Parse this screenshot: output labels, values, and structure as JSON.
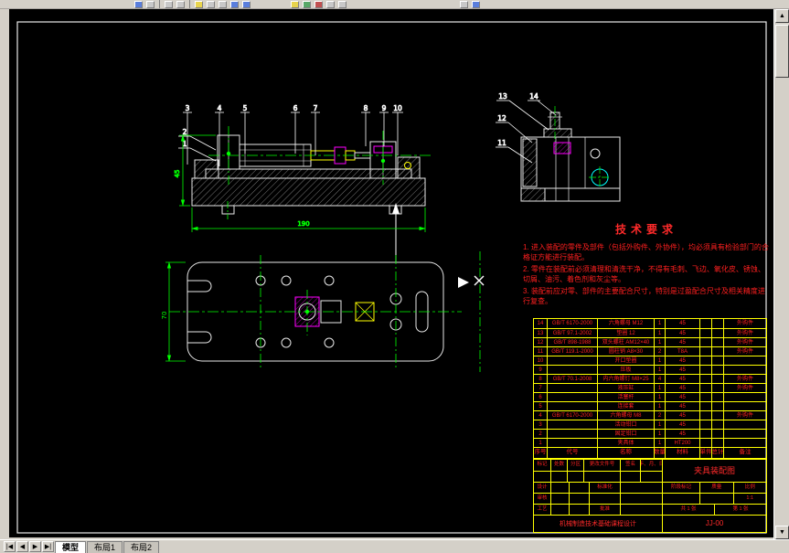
{
  "toolbar": {
    "icons": [
      "new",
      "open",
      "save",
      "print",
      "cut",
      "copy",
      "paste",
      "undo",
      "redo",
      "zoom-window",
      "zoom-previous",
      "pan",
      "layer",
      "color",
      "linetype",
      "help"
    ]
  },
  "scrollbar": {
    "up": "▲",
    "down": "▼"
  },
  "statusbar": {
    "nav": [
      "|◀",
      "◀",
      "▶",
      "▶|"
    ],
    "tabs": [
      "模型",
      "布局1",
      "布局2"
    ]
  },
  "drawing": {
    "balloons": {
      "b1": "1",
      "b2": "2",
      "b3": "3",
      "b4": "4",
      "b5": "5",
      "b6": "6",
      "b7": "7",
      "b8": "8",
      "b9": "9",
      "b10": "10",
      "b11": "11",
      "b12": "12",
      "b13": "13",
      "b14": "14"
    },
    "dims": {
      "front_width": "190",
      "front_height": "45",
      "plan_height": "70"
    },
    "tech": {
      "title": "技术要求",
      "items": [
        "1. 进入装配的零件及部件（包括外购件、外协件），均必须具有检验部门的合格证方能进行装配。",
        "2. 零件在装配前必须清理和清洗干净，不得有毛刺、飞边、氧化皮、锈蚀、切屑、油污、着色剂和灰尘等。",
        "3. 装配前应对零、部件的主要配合尺寸，特别是过盈配合尺寸及相关精度进行复查。"
      ]
    },
    "bom": {
      "headers": [
        "序号",
        "代号",
        "名称",
        "数量",
        "材料",
        "单件",
        "总计",
        "备注"
      ],
      "rows": [
        {
          "no": "14",
          "code": "GB/T 6170-2000",
          "name": "六角螺母 M12",
          "qty": "1",
          "mat": "45",
          "w1": "",
          "w2": "",
          "note": "外购件"
        },
        {
          "no": "13",
          "code": "GB/T 97.1-2002",
          "name": "垫圈 12",
          "qty": "1",
          "mat": "45",
          "w1": "",
          "w2": "",
          "note": "外购件"
        },
        {
          "no": "12",
          "code": "GB/T 898-1988",
          "name": "双头螺柱 AM12×40",
          "qty": "1",
          "mat": "45",
          "w1": "",
          "w2": "",
          "note": "外购件"
        },
        {
          "no": "11",
          "code": "GB/T 119.1-2000",
          "name": "圆柱销 A8×30",
          "qty": "2",
          "mat": "T8A",
          "w1": "",
          "w2": "",
          "note": "外购件"
        },
        {
          "no": "10",
          "code": "",
          "name": "开口垫圈",
          "qty": "1",
          "mat": "45",
          "w1": "",
          "w2": "",
          "note": ""
        },
        {
          "no": "9",
          "code": "",
          "name": "压板",
          "qty": "1",
          "mat": "45",
          "w1": "",
          "w2": "",
          "note": ""
        },
        {
          "no": "8",
          "code": "GB/T 70.1-2008",
          "name": "内六角螺钉 M8×25",
          "qty": "4",
          "mat": "45",
          "w1": "",
          "w2": "",
          "note": "外购件"
        },
        {
          "no": "7",
          "code": "",
          "name": "液压缸",
          "qty": "1",
          "mat": "45",
          "w1": "",
          "w2": "",
          "note": "外购件"
        },
        {
          "no": "6",
          "code": "",
          "name": "活塞杆",
          "qty": "1",
          "mat": "45",
          "w1": "",
          "w2": "",
          "note": ""
        },
        {
          "no": "5",
          "code": "",
          "name": "连接套",
          "qty": "1",
          "mat": "45",
          "w1": "",
          "w2": "",
          "note": ""
        },
        {
          "no": "4",
          "code": "GB/T 6170-2000",
          "name": "六角螺母 M8",
          "qty": "2",
          "mat": "45",
          "w1": "",
          "w2": "",
          "note": "外购件"
        },
        {
          "no": "3",
          "code": "",
          "name": "活动钳口",
          "qty": "1",
          "mat": "45",
          "w1": "",
          "w2": "",
          "note": ""
        },
        {
          "no": "2",
          "code": "",
          "name": "固定钳口",
          "qty": "1",
          "mat": "45",
          "w1": "",
          "w2": "",
          "note": ""
        },
        {
          "no": "1",
          "code": "",
          "name": "夹具体",
          "qty": "1",
          "mat": "HT200",
          "w1": "",
          "w2": "",
          "note": ""
        }
      ]
    },
    "tb": {
      "r1": [
        "标记",
        "处数",
        "分区",
        "更改文件号",
        "签名",
        "年、月、日"
      ],
      "design_label": "设计",
      "std_label": "标准化",
      "check_label": "审核",
      "process_label": "工艺",
      "approve_label": "批准",
      "org": "机械制造技术基础课程设计",
      "title": "夹具装配图",
      "stage_label": "阶段标记",
      "mass_label": "质量",
      "scale_label": "比例",
      "scale": "1:1",
      "sheets": "共 1 张",
      "sheet_no": "第 1 张",
      "code": "JJ-00"
    }
  }
}
